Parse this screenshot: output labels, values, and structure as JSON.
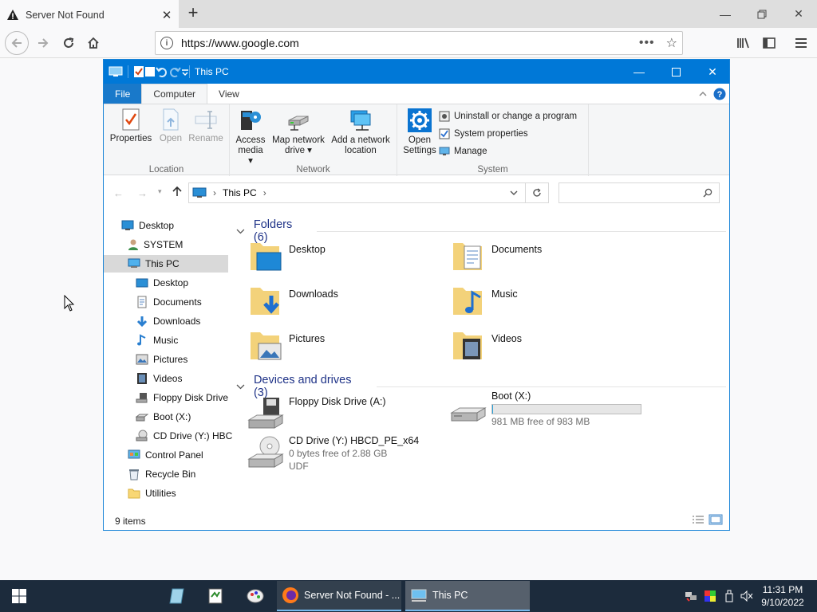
{
  "browser": {
    "tab_title": "Server Not Found",
    "url": "https://www.google.com"
  },
  "explorer": {
    "window_title": "This PC",
    "menu_tabs": [
      "File",
      "Computer",
      "View"
    ],
    "ribbon": {
      "location": {
        "label": "Location",
        "buttons": [
          "Properties",
          "Open",
          "Rename"
        ]
      },
      "network": {
        "label": "Network",
        "access_media": [
          "Access",
          "media"
        ],
        "map_drive": [
          "Map network",
          "drive"
        ],
        "add_location": [
          "Add a network",
          "location"
        ]
      },
      "system": {
        "label": "System",
        "open_settings": [
          "Open",
          "Settings"
        ],
        "items": [
          "Uninstall or change a program",
          "System properties",
          "Manage"
        ]
      }
    },
    "address": "This PC",
    "nav": [
      "Desktop",
      "SYSTEM",
      "This PC",
      "Desktop",
      "Documents",
      "Downloads",
      "Music",
      "Pictures",
      "Videos",
      "Floppy Disk Drive",
      "Boot (X:)",
      "CD Drive (Y:) HBC",
      "Control Panel",
      "Recycle Bin",
      "Utilities"
    ],
    "folders_header": "Folders (6)",
    "folders": [
      "Desktop",
      "Documents",
      "Downloads",
      "Music",
      "Pictures",
      "Videos"
    ],
    "devices_header": "Devices and drives (3)",
    "drives": {
      "floppy": {
        "name": "Floppy Disk Drive (A:)"
      },
      "boot": {
        "name": "Boot (X:)",
        "free": "981 MB free of 983 MB",
        "used_fraction": 0.002
      },
      "cd": {
        "name": "CD Drive (Y:) HBCD_PE_x64",
        "free": "0 bytes free of 2.88 GB",
        "fs": "UDF"
      }
    },
    "status": "9 items"
  },
  "taskbar": {
    "firefox_label": "Server Not Found - ...",
    "explorer_label": "This PC",
    "time": "11:31 PM",
    "date": "9/10/2022"
  }
}
